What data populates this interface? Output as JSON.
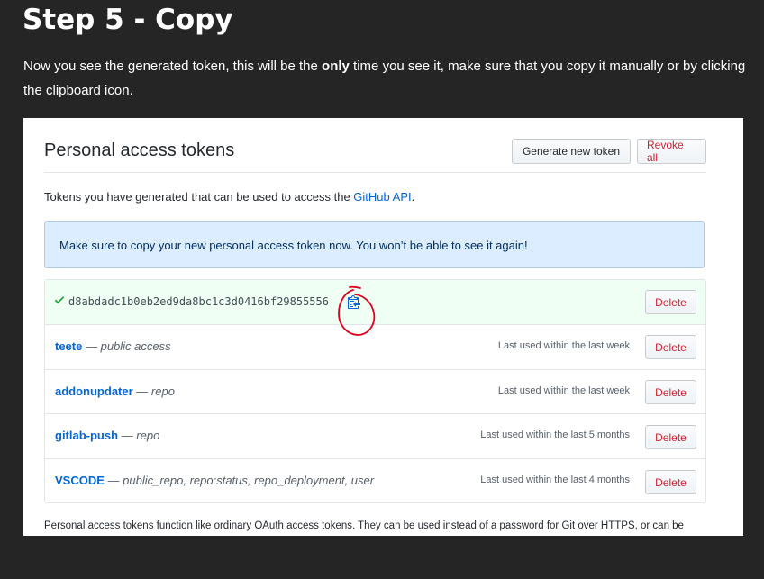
{
  "heading": "Step 5 - Copy",
  "intro": {
    "before": "Now you see the generated token, this will be the ",
    "emph": "only",
    "after": " time you see it, make sure that you copy it manually or by clicking the clipboard icon."
  },
  "card": {
    "title": "Personal access tokens",
    "generate_label": "Generate new token",
    "revoke_label": "Revoke all",
    "description_before": "Tokens you have generated that can be used to access the ",
    "description_link": "GitHub API",
    "description_after": ".",
    "flash_message": "Make sure to copy your new personal access token now. You won’t be able to see it again!",
    "new_token": {
      "value": "d8abdadc1b0eb2ed9da8bc1c3d0416bf29855556",
      "delete_label": "Delete"
    },
    "tokens": [
      {
        "name": "teete",
        "separator": " — ",
        "scopes": "public access",
        "last_used": "Last used within the last week",
        "delete_label": "Delete"
      },
      {
        "name": "addonupdater",
        "separator": " — ",
        "scopes": "repo",
        "last_used": "Last used within the last week",
        "delete_label": "Delete"
      },
      {
        "name": "gitlab-push",
        "separator": " — ",
        "scopes": "repo",
        "last_used": "Last used within the last 5 months",
        "delete_label": "Delete"
      },
      {
        "name": "VSCODE",
        "separator": " — ",
        "scopes": "public_repo, repo:status, repo_deployment, user",
        "last_used": "Last used within the last 4 months",
        "delete_label": "Delete"
      }
    ],
    "footnote": "Personal access tokens function like ordinary OAuth access tokens. They can be used instead of a password for Git over HTTPS, or can be"
  },
  "colors": {
    "page_bg": "#252526",
    "link": "#0366d6",
    "danger": "#cb2431",
    "success": "#28a745",
    "flash_bg": "#dbedff",
    "annotation": "#e0001b"
  },
  "icons": {
    "check": "check-icon",
    "clipboard": "clipboard-icon"
  }
}
